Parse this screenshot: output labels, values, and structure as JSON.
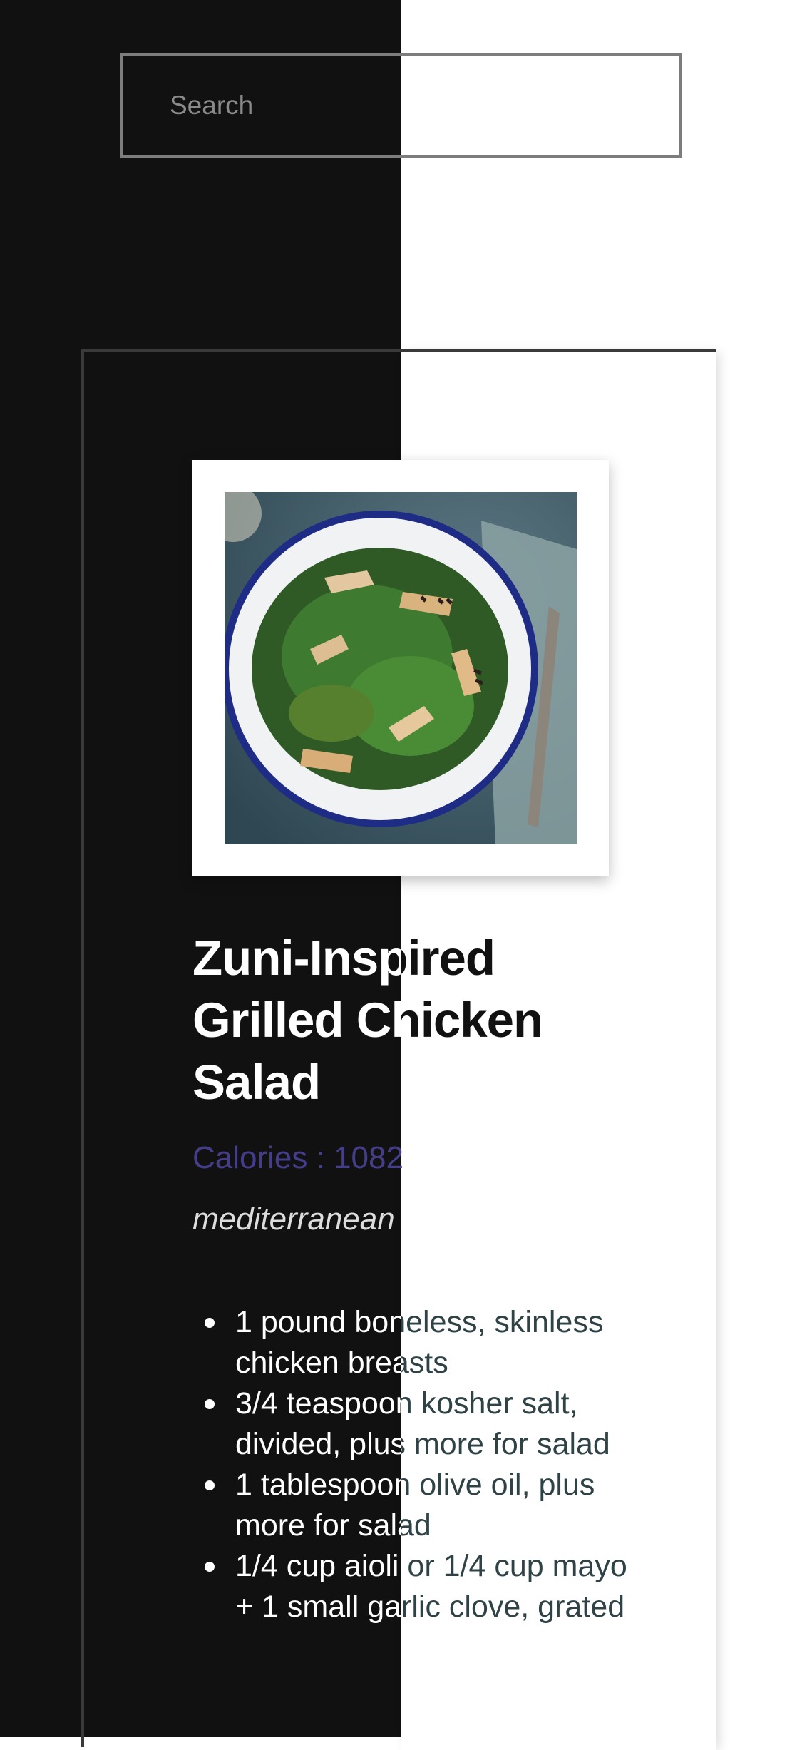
{
  "search": {
    "placeholder": "Search",
    "value": ""
  },
  "recipe": {
    "title": "Zuni-Inspired Grilled Chicken Salad",
    "calories": "Calories : 1082",
    "cuisine": "mediterranean",
    "ingredients": [
      "1 pound boneless, skinless chicken breasts",
      "3/4 teaspoon kosher salt, divided, plus more for salad",
      "1 tablespoon olive oil, plus more for salad",
      "1/4 cup aioli or 1/4 cup mayo + 1 small garlic clove, grated"
    ],
    "image_icon": "salad-photo"
  },
  "colors": {
    "dark_bg": "#111111",
    "light_bg": "#ffffff",
    "calories": "#443d8a",
    "ingredient_dark": "#2f4245"
  }
}
